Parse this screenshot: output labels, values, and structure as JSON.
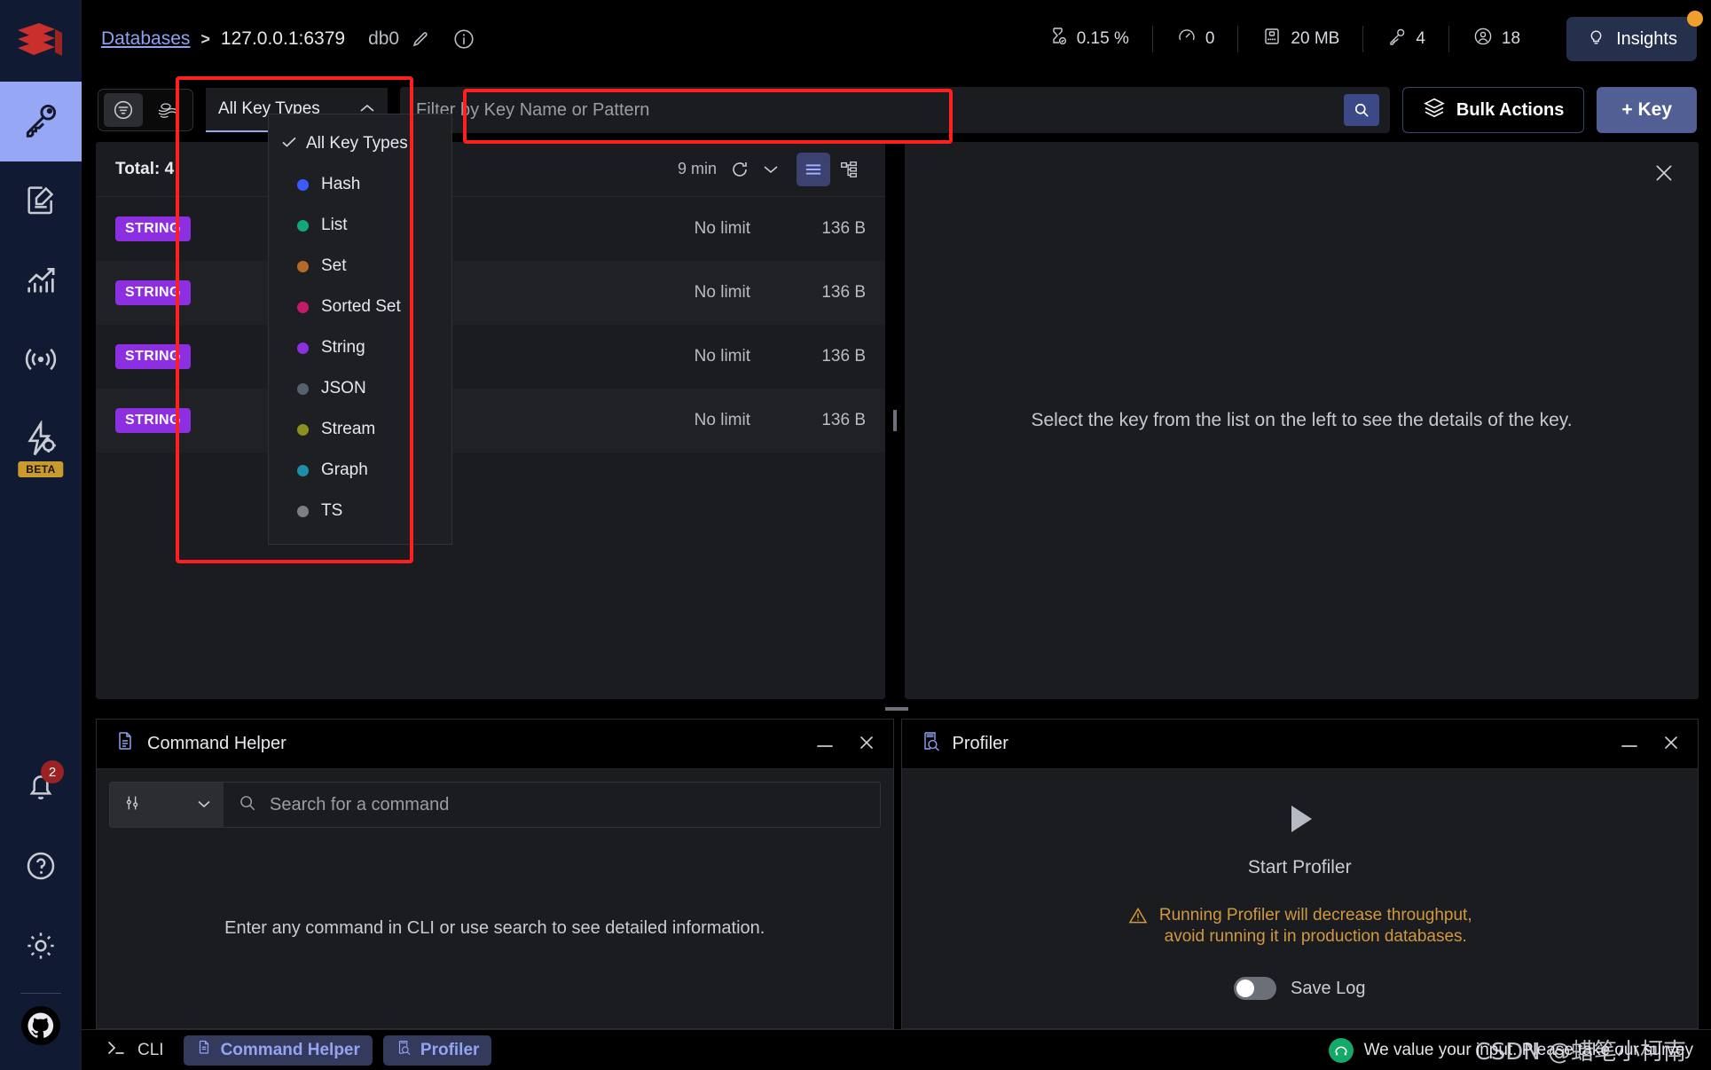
{
  "rail": {
    "logo_name": "redis-logo",
    "items": [
      {
        "name": "browser",
        "icon": "key-icon",
        "active": true
      },
      {
        "name": "workbench",
        "icon": "edit-document-icon",
        "active": false
      },
      {
        "name": "analysis-tools",
        "icon": "bar-chart-icon",
        "active": false
      },
      {
        "name": "pub-sub",
        "icon": "broadcast-icon",
        "active": false
      },
      {
        "name": "triggers-and-functions",
        "icon": "lightning-gear-icon",
        "active": false,
        "badge": "BETA"
      }
    ],
    "bottom_items": [
      {
        "name": "notifications",
        "icon": "bell-icon",
        "badge": "2"
      },
      {
        "name": "help",
        "icon": "question-circle-icon"
      },
      {
        "name": "settings",
        "icon": "gear-icon"
      },
      {
        "name": "github",
        "icon": "github-icon"
      }
    ]
  },
  "header": {
    "breadcrumb_link": "Databases",
    "separator": ">",
    "host": "127.0.0.1:6379",
    "database": "db0",
    "edit_icon": "pencil-icon",
    "info_icon": "info-circle-icon",
    "stats": [
      {
        "icon": "hourglass-check-icon",
        "value": "0.15 %"
      },
      {
        "icon": "gauge-icon",
        "value": "0"
      },
      {
        "icon": "memory-card-icon",
        "value": "20 MB"
      },
      {
        "icon": "key-icon",
        "value": "4"
      },
      {
        "icon": "user-circle-icon",
        "value": "18"
      }
    ],
    "insights_label": "Insights"
  },
  "keytoolbar": {
    "filter_icon": "filter-circle-icon",
    "scan_icon": "noodles-icon",
    "type_select_value": "All Key Types",
    "filter_placeholder": "Filter by Key Name or Pattern",
    "filter_value": "",
    "search_icon": "search-icon",
    "bulk_actions_label": "Bulk Actions",
    "add_key_label": "+ Key"
  },
  "key_types_dropdown": {
    "all_label": "All Key Types",
    "options": [
      {
        "label": "Hash",
        "color": "#3a5afc"
      },
      {
        "label": "List",
        "color": "#14a77b"
      },
      {
        "label": "Set",
        "color": "#b56a2a"
      },
      {
        "label": "Sorted Set",
        "color": "#c31b6a"
      },
      {
        "label": "String",
        "color": "#8b2fe0"
      },
      {
        "label": "JSON",
        "color": "#55616f"
      },
      {
        "label": "Stream",
        "color": "#8b9020"
      },
      {
        "label": "Graph",
        "color": "#1d8fa8"
      },
      {
        "label": "TS",
        "color": "#7c7f86"
      }
    ]
  },
  "keylist": {
    "total_label": "Total: 4",
    "refresh_time": "9 min",
    "refresh_icon": "refresh-icon",
    "chevron_icon": "chevron-down-icon",
    "view_list_icon": "list-view-icon",
    "view_tree_icon": "tree-view-icon",
    "rows": [
      {
        "type": "STRING",
        "name": "",
        "ttl": "No limit",
        "size": "136 B"
      },
      {
        "type": "STRING",
        "name": "",
        "ttl": "No limit",
        "size": "136 B"
      },
      {
        "type": "STRING",
        "name": "",
        "ttl": "No limit",
        "size": "136 B"
      },
      {
        "type": "STRING",
        "name": "",
        "ttl": "No limit",
        "size": "136 B"
      }
    ]
  },
  "details": {
    "empty_message": "Select the key from the list on the left to see the details of the key.",
    "close_icon": "close-icon"
  },
  "command_helper": {
    "icon": "document-icon",
    "title": "Command Helper",
    "minimize_icon": "minimize-icon",
    "close_icon": "close-icon",
    "filter_icon": "sliders-icon",
    "chevron_icon": "chevron-down-icon",
    "search_icon": "search-icon",
    "search_placeholder": "Search for a command",
    "search_value": "",
    "hint": "Enter any command in CLI or use search to see detailed information."
  },
  "profiler": {
    "icon": "profiler-search-icon",
    "title": "Profiler",
    "minimize_icon": "minimize-icon",
    "close_icon": "close-icon",
    "play_icon": "play-icon",
    "start_label": "Start Profiler",
    "warning_icon": "warning-triangle-icon",
    "warning_line1": "Running Profiler will decrease throughput,",
    "warning_line2": "avoid running it in production databases.",
    "save_log_label": "Save Log",
    "save_log_on": false
  },
  "statusbar": {
    "cli_icon": "terminal-icon",
    "cli_label": "CLI",
    "command_helper_label": "Command Helper",
    "profiler_label": "Profiler",
    "feedback_icon": "feedback-icon",
    "feedback_message": "We value your input. Please take our survey"
  },
  "watermark": "CSDN @蜡笔小柯南",
  "colors": {
    "accent": "#525f94",
    "highlight_box": "#ff1f1f",
    "badge_string": "#8b2fe0",
    "rail_bg": "#111a33",
    "rail_active": "#96a7f5",
    "warning": "#d2983f"
  }
}
